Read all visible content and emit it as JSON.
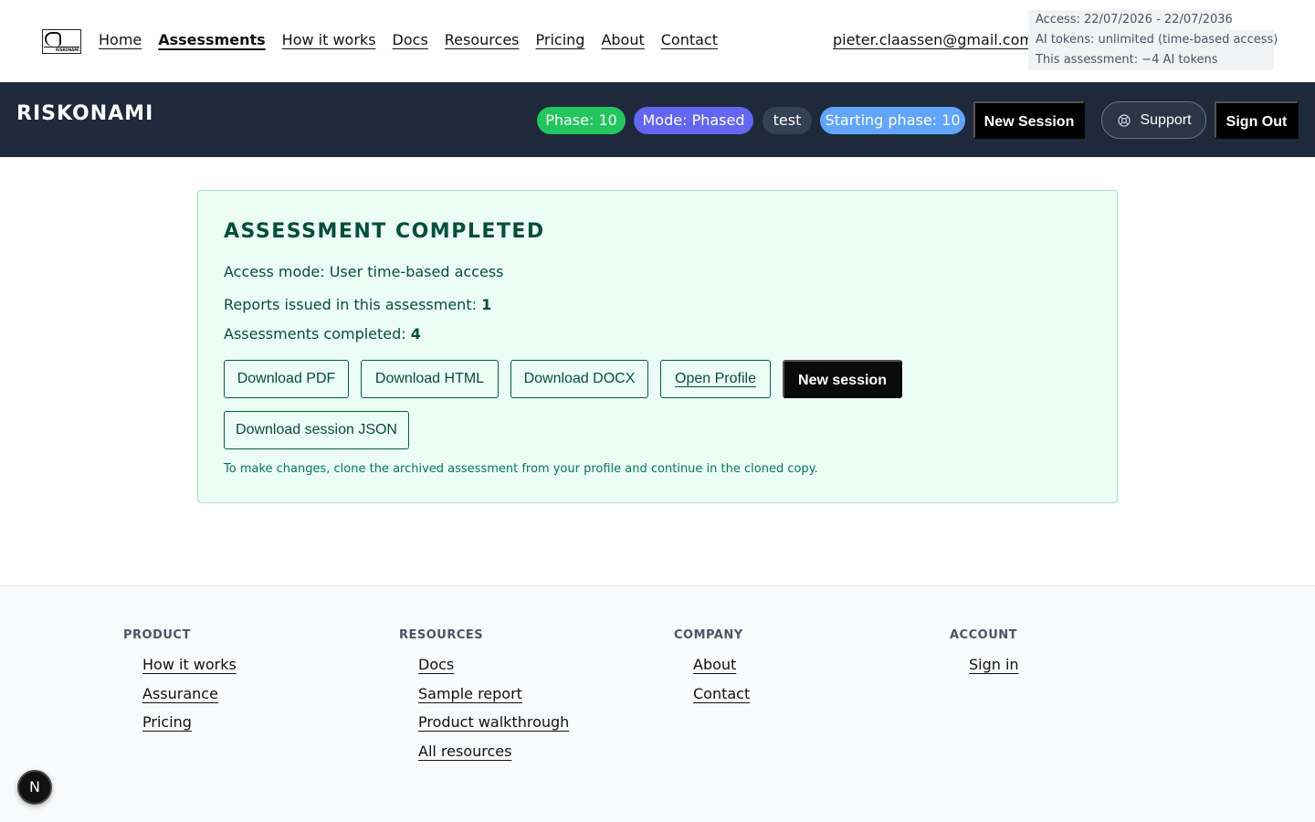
{
  "nav": {
    "links": [
      "Home",
      "Assessments",
      "How it works",
      "Docs",
      "Resources",
      "Pricing",
      "About",
      "Contact"
    ],
    "active": "Assessments",
    "email": "pieter.claassen@gmail.com",
    "logo_text": "RISKONAMI"
  },
  "access": {
    "line1": "Access: 22/07/2026 - 22/07/2036",
    "line2": "AI tokens: unlimited (time-based access)",
    "line3": "This assessment: −4 AI tokens"
  },
  "bar": {
    "brand": "RISKONAMI",
    "phase": "Phase: 10",
    "mode": "Mode: Phased",
    "tag": "test",
    "starting_phase": "Starting phase: 10",
    "new_session": "New Session",
    "support": "Support",
    "sign_out": "Sign Out"
  },
  "card": {
    "title": "ASSESSMENT COMPLETED",
    "access_mode": "Access mode: User time-based access",
    "reports_label": "Reports issued in this assessment: ",
    "reports_value": "1",
    "completed_label": "Assessments completed: ",
    "completed_value": "4",
    "buttons": {
      "pdf": "Download PDF",
      "html": "Download HTML",
      "docx": "Download DOCX",
      "profile": "Open Profile",
      "new_session": "New session",
      "json": "Download session JSON"
    },
    "note": "To make changes, clone the archived assessment from your profile and continue in the cloned copy."
  },
  "footer": {
    "product": {
      "heading": "PRODUCT",
      "links": [
        "How it works",
        "Assurance",
        "Pricing"
      ]
    },
    "resources": {
      "heading": "RESOURCES",
      "links": [
        "Docs",
        "Sample report",
        "Product walkthrough",
        "All resources"
      ]
    },
    "company": {
      "heading": "COMPANY",
      "links": [
        "About",
        "Contact"
      ]
    },
    "account": {
      "heading": "ACCOUNT",
      "links": [
        "Sign in"
      ]
    }
  },
  "badge": "N",
  "colors": {
    "dark_bar": "#1e293b",
    "phase_pill": "#22c55e",
    "mode_pill": "#6366f1",
    "start_pill": "#60a5fa",
    "card_bg": "#ecfdf5"
  }
}
